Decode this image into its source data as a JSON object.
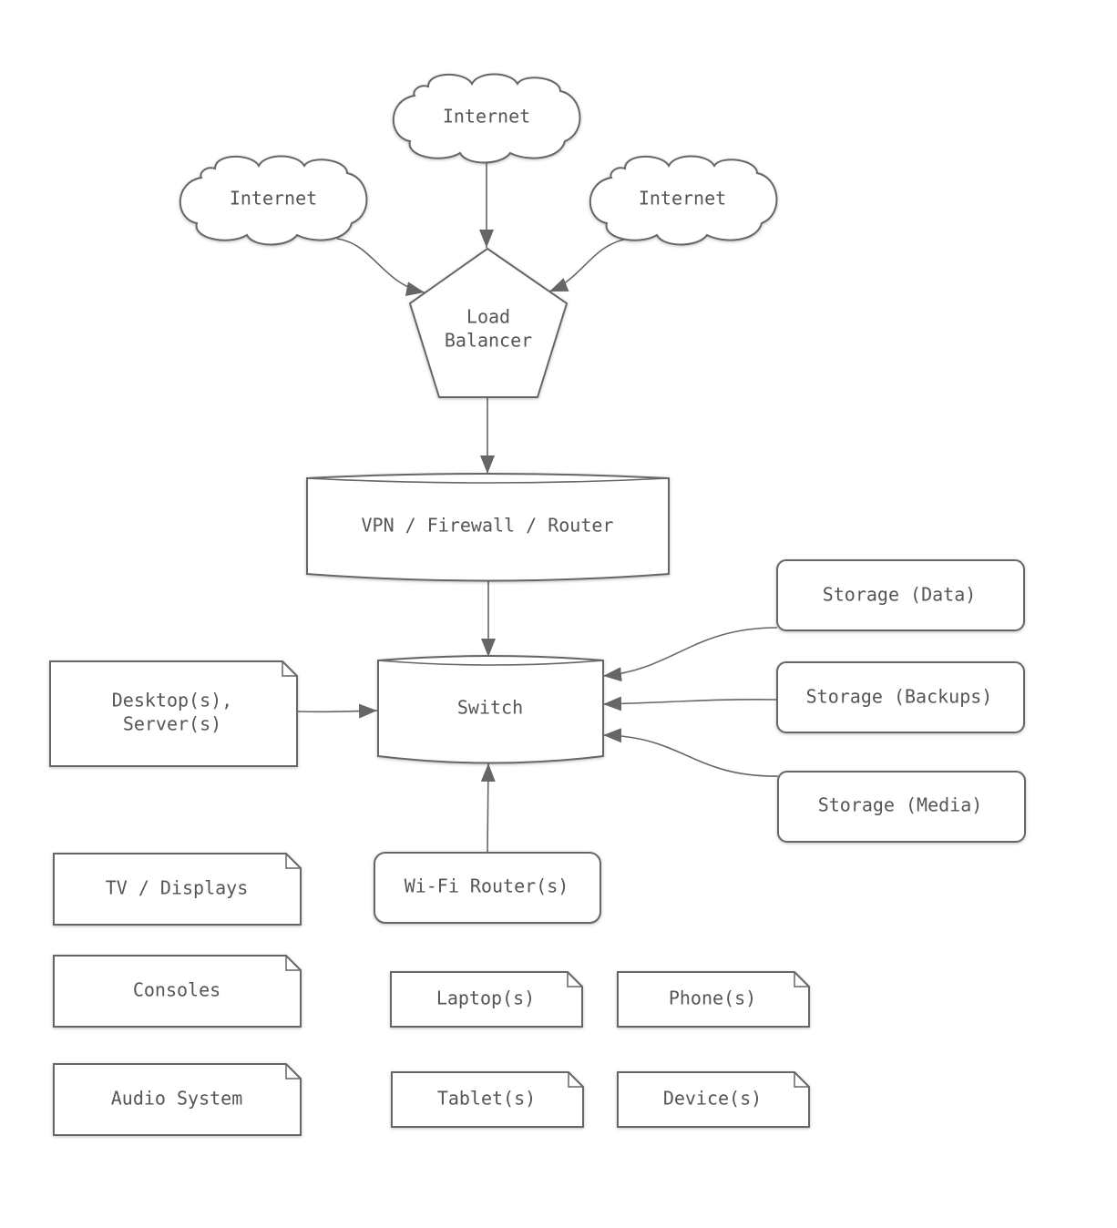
{
  "diagram": {
    "nodes": {
      "internet_top": {
        "label": "Internet",
        "shape": "cloud"
      },
      "internet_left": {
        "label": "Internet",
        "shape": "cloud"
      },
      "internet_right": {
        "label": "Internet",
        "shape": "cloud"
      },
      "load_balancer": {
        "label_lines": [
          "Load",
          "Balancer"
        ],
        "shape": "pentagon"
      },
      "vpn": {
        "label": "VPN / Firewall / Router",
        "shape": "cylinder"
      },
      "switch": {
        "label": "Switch",
        "shape": "cylinder"
      },
      "desktops": {
        "label_lines": [
          "Desktop(s),",
          "Server(s)"
        ],
        "shape": "note"
      },
      "storage_data": {
        "label": "Storage (Data)",
        "shape": "rounded-rect"
      },
      "storage_backups": {
        "label": "Storage (Backups)",
        "shape": "rounded-rect"
      },
      "storage_media": {
        "label": "Storage (Media)",
        "shape": "rounded-rect"
      },
      "wifi_router": {
        "label": "Wi-Fi Router(s)",
        "shape": "rounded-rect"
      },
      "tv_displays": {
        "label": "TV / Displays",
        "shape": "note"
      },
      "consoles": {
        "label": "Consoles",
        "shape": "note"
      },
      "audio_system": {
        "label": "Audio System",
        "shape": "note"
      },
      "laptops": {
        "label": "Laptop(s)",
        "shape": "note"
      },
      "phones": {
        "label": "Phone(s)",
        "shape": "note"
      },
      "tablets": {
        "label": "Tablet(s)",
        "shape": "note"
      },
      "devices": {
        "label": "Device(s)",
        "shape": "note"
      }
    },
    "edges": [
      {
        "from": "internet_top",
        "to": "load_balancer"
      },
      {
        "from": "internet_left",
        "to": "load_balancer"
      },
      {
        "from": "internet_right",
        "to": "load_balancer"
      },
      {
        "from": "load_balancer",
        "to": "vpn"
      },
      {
        "from": "vpn",
        "to": "switch"
      },
      {
        "from": "desktops",
        "to": "switch"
      },
      {
        "from": "storage_data",
        "to": "switch"
      },
      {
        "from": "storage_backups",
        "to": "switch"
      },
      {
        "from": "storage_media",
        "to": "switch"
      },
      {
        "from": "wifi_router",
        "to": "switch"
      }
    ]
  }
}
